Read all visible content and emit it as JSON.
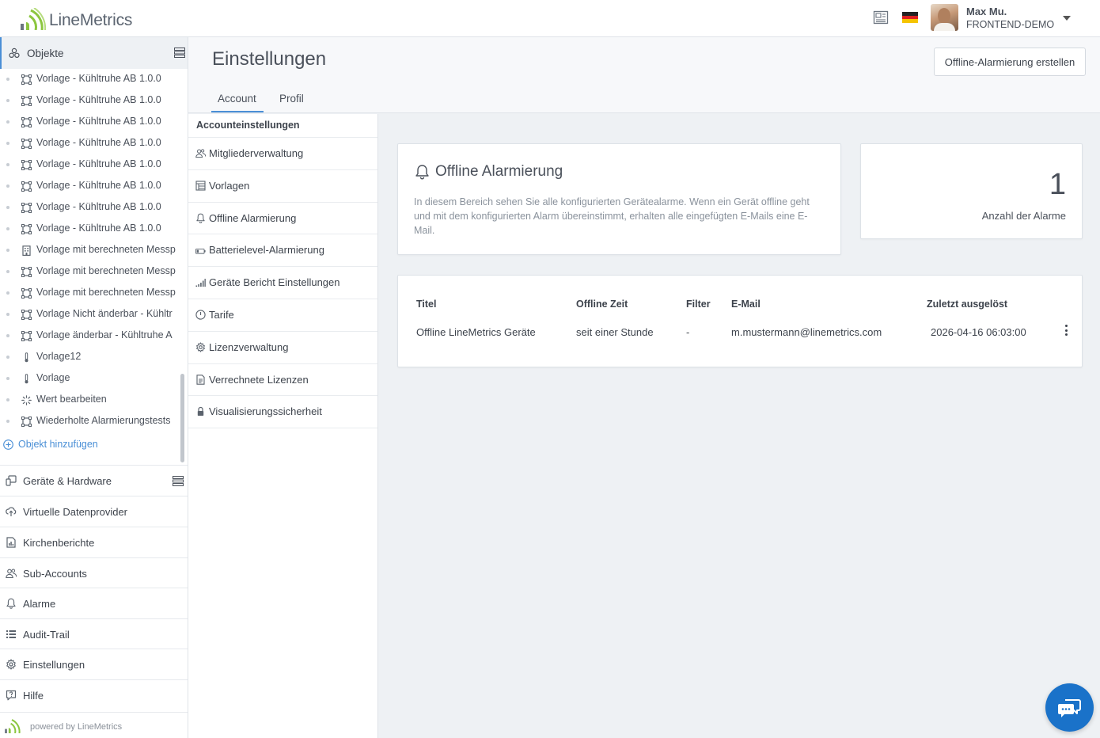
{
  "header": {
    "logo_text": "LineMetrics",
    "user_name": "Max Mu.",
    "user_org": "FRONTEND-DEMO",
    "icons": [
      "news-icon",
      "flag-de-icon",
      "avatar",
      "chevron-down-icon"
    ]
  },
  "sidebar": {
    "objects_label": "Objekte",
    "tree": [
      {
        "label": "Vorlage - Kühltruhe AB 1.0.0",
        "icon": "frame-icon"
      },
      {
        "label": "Vorlage - Kühltruhe AB 1.0.0",
        "icon": "frame-icon"
      },
      {
        "label": "Vorlage - Kühltruhe AB 1.0.0",
        "icon": "frame-icon"
      },
      {
        "label": "Vorlage - Kühltruhe AB 1.0.0",
        "icon": "frame-icon"
      },
      {
        "label": "Vorlage - Kühltruhe AB 1.0.0",
        "icon": "frame-icon"
      },
      {
        "label": "Vorlage - Kühltruhe AB 1.0.0",
        "icon": "frame-icon"
      },
      {
        "label": "Vorlage - Kühltruhe AB 1.0.0",
        "icon": "frame-icon"
      },
      {
        "label": "Vorlage - Kühltruhe AB 1.0.0",
        "icon": "frame-icon"
      },
      {
        "label": "Vorlage mit berechneten Messp",
        "icon": "building-icon"
      },
      {
        "label": "Vorlage mit berechneten Messp",
        "icon": "frame-icon"
      },
      {
        "label": "Vorlage mit berechneten Messp",
        "icon": "frame-icon"
      },
      {
        "label": "Vorlage Nicht änderbar - Kühltr",
        "icon": "frame-icon"
      },
      {
        "label": "Vorlage änderbar - Kühltruhe A",
        "icon": "frame-icon"
      },
      {
        "label": "Vorlage12",
        "icon": "thermometer-icon"
      },
      {
        "label": "Vorlage",
        "icon": "thermometer-icon"
      },
      {
        "label": "Wert bearbeiten",
        "icon": "spinner-icon"
      },
      {
        "label": "Wiederholte Alarmierungstests",
        "icon": "frame-icon"
      }
    ],
    "add_object": "Objekt hinzufügen",
    "nav": [
      {
        "label": "Geräte & Hardware",
        "icon": "devices-icon"
      },
      {
        "label": "Virtuelle Datenprovider",
        "icon": "cloud-upload-icon"
      },
      {
        "label": "Kirchenberichte",
        "icon": "report-icon"
      },
      {
        "label": "Sub-Accounts",
        "icon": "users-icon"
      },
      {
        "label": "Alarme",
        "icon": "bell-icon"
      },
      {
        "label": "Audit-Trail",
        "icon": "list-icon"
      },
      {
        "label": "Einstellungen",
        "icon": "gear-icon"
      },
      {
        "label": "Hilfe",
        "icon": "help-icon"
      }
    ],
    "powered_by": "powered by LineMetrics"
  },
  "page": {
    "title": "Einstellungen",
    "create_button": "Offline-Alarmierung erstellen",
    "tabs": [
      {
        "label": "Account",
        "active": true
      },
      {
        "label": "Profil",
        "active": false
      }
    ]
  },
  "settings_menu": {
    "heading": "Accounteinstellungen",
    "items": [
      {
        "label": "Mitgliederverwaltung",
        "icon": "users-icon"
      },
      {
        "label": "Vorlagen",
        "icon": "template-icon"
      },
      {
        "label": "Offline Alarmierung",
        "icon": "bell-icon",
        "active": true
      },
      {
        "label": "Batterielevel-Alarmierung",
        "icon": "battery-icon"
      },
      {
        "label": "Geräte Bericht Einstellungen",
        "icon": "signal-icon"
      },
      {
        "label": "Tarife",
        "icon": "clock-icon"
      },
      {
        "label": "Lizenzverwaltung",
        "icon": "gear-icon"
      },
      {
        "label": "Verrechnete Lizenzen",
        "icon": "document-icon"
      },
      {
        "label": "Visualisierungssicherheit",
        "icon": "lock-icon"
      }
    ]
  },
  "info_card": {
    "title": "Offline Alarmierung",
    "description": "In diesem Bereich sehen Sie alle konfigurierten Gerätealarme. Wenn ein Gerät offline geht und mit dem konfigurierten Alarm übereinstimmt, erhalten alle eingefügten E-Mails eine E-Mail."
  },
  "count_card": {
    "count": "1",
    "label": "Anzahl der Alarme"
  },
  "alarm_table": {
    "columns": [
      "Titel",
      "Offline Zeit",
      "Filter",
      "E-Mail",
      "Zuletzt ausgelöst"
    ],
    "rows": [
      [
        "Offline LineMetrics Geräte",
        "seit einer Stunde",
        "-",
        "m.mustermann@linemetrics.com",
        "2026-04-16 06:03:00"
      ]
    ]
  },
  "colors": {
    "accent": "#4a8fd6",
    "logo_green": "#8cc63f",
    "chat_blue": "#1a72c9",
    "page_bg": "#eef1f4"
  }
}
